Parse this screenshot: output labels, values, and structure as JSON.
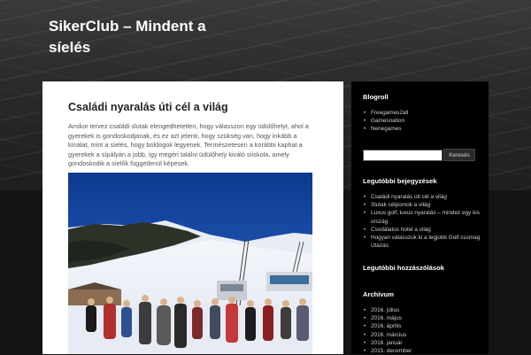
{
  "site": {
    "title": "SikerClub – Mindent a síelés"
  },
  "post": {
    "title": "Családi nyaralás úti cél a világ",
    "body": "Amikor tervez családi slutak elengedhetetlen, hogy válasszon egy üdülőhelyt, ahol a gyerekek is gondoskodjanak, és ez azt jelenti, hogy szükség van, hogy inkább a kínálat, mint a síelés, hogy boldogok legyenek. Természetesen a korábbi kaphat a gyerekek a sípályán a jobb, így megéri találni üdülőhely kiváló síiskola, amely gondoskodik a síelők független­ül képesek."
  },
  "sidebar": {
    "blogroll_title": "Blogroll",
    "blogroll": [
      "Freegames2all",
      "Gamesnation",
      "Nenegames"
    ],
    "search_button": "Keresés",
    "recent_posts_title": "Legutóbbi bejegyzések",
    "recent_posts": [
      "Családi nyaralás úti cél a világ",
      "Slutak célpontok a világ",
      "Luxus golf, luxus nyaralás – mindez egy kis ország",
      "Csodálatos hotel a világ",
      "Hogyan válasszuk ki a legjobb Golf cssmag Utazás"
    ],
    "recent_comments_title": "Legutóbbi hozzászólások",
    "archive_title": "Archívum",
    "archive": [
      "2016. július",
      "2016. május",
      "2016. április",
      "2016. március",
      "2016. január",
      "2015. december"
    ]
  },
  "colors": {
    "page_bg": "#141414",
    "sidebar_bg": "#000000",
    "content_bg": "#ffffff"
  }
}
